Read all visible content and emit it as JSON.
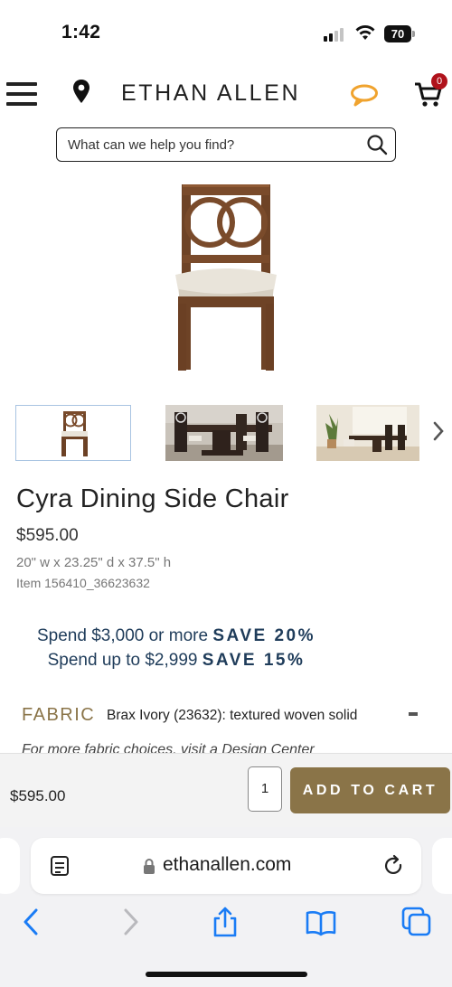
{
  "status_bar": {
    "time": "1:42",
    "battery": "70"
  },
  "header": {
    "brand": "ETHAN ALLEN",
    "cart_count": "0",
    "icons": [
      "menu-icon",
      "location-pin-icon",
      "chat-icon",
      "cart-icon"
    ],
    "accent_color": "#f0a32e"
  },
  "search": {
    "placeholder": "What can we help you find?"
  },
  "product": {
    "title": "Cyra Dining Side Chair",
    "price": "$595.00",
    "dimensions": "20\" w x 23.25\" d x 37.5\" h",
    "item_number": "Item 156410_36623632",
    "thumbnails": [
      "chair-thumbnail",
      "dining-room-thumbnail-1",
      "dining-room-thumbnail-2"
    ]
  },
  "promo": {
    "line1_text": "Spend $3,000 or more ",
    "line1_save": "SAVE 20%",
    "line2_text": "Spend up to $2,999 ",
    "line2_save": "SAVE 15%",
    "color": "#1f3c5a"
  },
  "fabric": {
    "label": "FABRIC",
    "value": "Brax Ivory (23632): textured woven solid",
    "toggle": "-",
    "note": "For more fabric choices, visit a Design Center"
  },
  "cart_bar": {
    "price": "$595.00",
    "quantity": "1",
    "button_label": "ADD TO CART",
    "button_color": "#8a7448"
  },
  "browser": {
    "url": "ethanallen.com",
    "toolbar": [
      "back-icon",
      "forward-icon",
      "share-icon",
      "bookmarks-icon",
      "tabs-icon"
    ]
  }
}
